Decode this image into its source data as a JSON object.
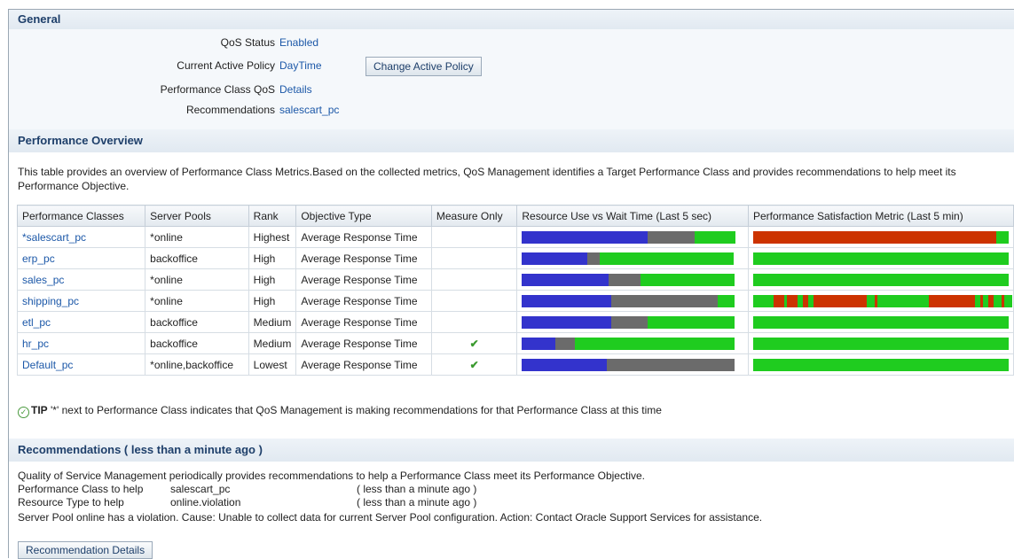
{
  "colors": {
    "link": "#1c58a8",
    "header_text": "#1e3f6a",
    "blue": "#3333cc",
    "gray": "#6b6b6b",
    "green": "#1fcc1f",
    "red": "#cc3300"
  },
  "general": {
    "title": "General",
    "qos_status_label": "QoS Status",
    "qos_status_value": "Enabled",
    "active_policy_label": "Current Active Policy",
    "active_policy_value": "DayTime",
    "change_policy_button": "Change Active Policy",
    "pc_qos_label": "Performance Class QoS",
    "pc_qos_value": "Details",
    "recommendations_label": "Recommendations",
    "recommendations_value": "salescart_pc"
  },
  "overview": {
    "title": "Performance Overview",
    "description": "This table provides an overview of Performance Class Metrics.Based on the collected metrics, QoS Management identifies a Target Performance Class and provides recommendations to help meet its Performance Objective.",
    "columns": [
      "Performance Classes",
      "Server Pools",
      "Rank",
      "Objective Type",
      "Measure Only",
      "Resource Use vs Wait Time (Last 5 sec)",
      "Performance Satisfaction Metric (Last 5 min)"
    ],
    "rows": [
      {
        "name": "*salescart_pc",
        "pools": "*online",
        "rank": "Highest",
        "objective": "Average Response Time",
        "measure_only": false,
        "resource": {
          "blue": 0.59,
          "gray": 0.22,
          "green": 0.19
        },
        "satisfaction": [
          [
            "red",
            0.95
          ],
          [
            "green",
            0.05
          ]
        ]
      },
      {
        "name": "erp_pc",
        "pools": "backoffice",
        "rank": "High",
        "objective": "Average Response Time",
        "measure_only": false,
        "resource": {
          "blue": 0.31,
          "gray": 0.06,
          "green": 0.63
        },
        "satisfaction": [
          [
            "green",
            1.0
          ]
        ]
      },
      {
        "name": "sales_pc",
        "pools": "*online",
        "rank": "High",
        "objective": "Average Response Time",
        "measure_only": false,
        "resource": {
          "blue": 0.41,
          "gray": 0.15,
          "green": 0.44
        },
        "satisfaction": [
          [
            "green",
            1.0
          ]
        ]
      },
      {
        "name": "shipping_pc",
        "pools": "*online",
        "rank": "High",
        "objective": "Average Response Time",
        "measure_only": false,
        "resource": {
          "blue": 0.42,
          "gray": 0.5,
          "green": 0.08
        },
        "satisfaction": [
          [
            "green",
            0.08
          ],
          [
            "red",
            0.04
          ],
          [
            "green",
            0.01
          ],
          [
            "red",
            0.04
          ],
          [
            "green",
            0.02
          ],
          [
            "red",
            0.02
          ],
          [
            "green",
            0.02
          ],
          [
            "red",
            0.21
          ],
          [
            "green",
            0.03
          ],
          [
            "red",
            0.01
          ],
          [
            "green",
            0.2
          ],
          [
            "red",
            0.18
          ],
          [
            "green",
            0.02
          ],
          [
            "red",
            0.01
          ],
          [
            "green",
            0.02
          ],
          [
            "red",
            0.02
          ],
          [
            "green",
            0.03
          ],
          [
            "red",
            0.01
          ],
          [
            "green",
            0.03
          ]
        ]
      },
      {
        "name": "etl_pc",
        "pools": "backoffice",
        "rank": "Medium",
        "objective": "Average Response Time",
        "measure_only": false,
        "resource": {
          "blue": 0.42,
          "gray": 0.17,
          "green": 0.41
        },
        "satisfaction": [
          [
            "green",
            1.0
          ]
        ]
      },
      {
        "name": "hr_pc",
        "pools": "backoffice",
        "rank": "Medium",
        "objective": "Average Response Time",
        "measure_only": true,
        "resource": {
          "blue": 0.16,
          "gray": 0.09,
          "green": 0.75
        },
        "satisfaction": [
          [
            "green",
            1.0
          ]
        ]
      },
      {
        "name": "Default_pc",
        "pools": "*online,backoffice",
        "rank": "Lowest",
        "objective": "Average Response Time",
        "measure_only": true,
        "resource": {
          "blue": 0.4,
          "gray": 0.6,
          "green": 0.0
        },
        "satisfaction": [
          [
            "green",
            1.0
          ]
        ]
      }
    ],
    "check_glyph": "✔"
  },
  "tip": {
    "label": "TIP",
    "text": "'*' next to Performance Class indicates that QoS Management is making recommendations for that Performance Class at this time"
  },
  "recommendations": {
    "title": "Recommendations ( less than a minute ago )",
    "intro": "Quality of Service Management periodically provides recommendations to help a Performance Class meet its Performance Objective.",
    "pc_label": "Performance Class to help",
    "pc_value": "salescart_pc",
    "pc_time": "( less than a minute ago )",
    "rt_label": "Resource Type to help",
    "rt_value": "online.violation",
    "rt_time": "( less than a minute ago )",
    "message": "Server Pool online has a violation. Cause: Unable to collect data for current Server Pool configuration. Action: Contact Oracle Support Services for assistance.",
    "details_button": "Recommendation Details"
  }
}
